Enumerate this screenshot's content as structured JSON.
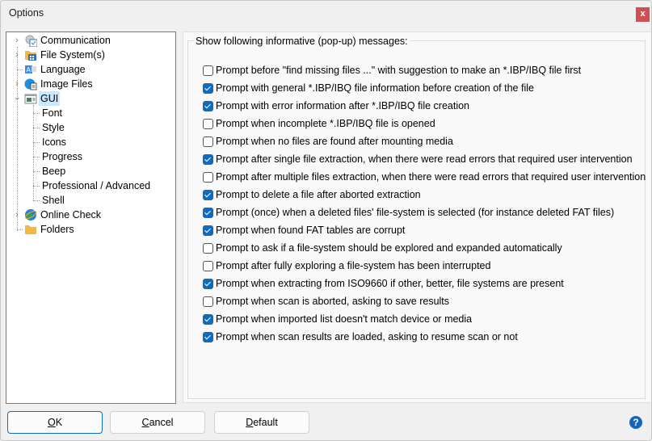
{
  "window": {
    "title": "Options",
    "close_label": "x"
  },
  "tree": {
    "items": [
      {
        "label": "Communication",
        "icon": "gear-checklist-icon",
        "expandable": true,
        "expanded": false,
        "level": 0
      },
      {
        "label": "File System(s)",
        "icon": "folder-grid-icon",
        "expandable": true,
        "expanded": false,
        "level": 0
      },
      {
        "label": "Language",
        "icon": "language-icon",
        "expandable": false,
        "level": 0
      },
      {
        "label": "Image Files",
        "icon": "image-file-icon",
        "expandable": true,
        "expanded": false,
        "level": 0
      },
      {
        "label": "GUI",
        "icon": "window-icon",
        "expandable": true,
        "expanded": true,
        "level": 0,
        "selected": true
      },
      {
        "label": "Font",
        "level": 1
      },
      {
        "label": "Style",
        "level": 1
      },
      {
        "label": "Icons",
        "level": 1
      },
      {
        "label": "Progress",
        "level": 1
      },
      {
        "label": "Beep",
        "level": 1
      },
      {
        "label": "Professional / Advanced",
        "level": 1
      },
      {
        "label": "Shell",
        "level": 1
      },
      {
        "label": "Online Check",
        "icon": "globe-icon",
        "expandable": true,
        "expanded": false,
        "level": 0
      },
      {
        "label": "Folders",
        "icon": "folder-icon",
        "expandable": false,
        "level": 0
      }
    ]
  },
  "messages_group": {
    "title": "Show following informative (pop-up) messages:",
    "options": [
      {
        "label": "Prompt before \"find missing files ...\" with suggestion to make an *.IBP/IBQ file first",
        "checked": false
      },
      {
        "label": "Prompt with general *.IBP/IBQ file information before creation of the file",
        "checked": true
      },
      {
        "label": "Prompt with error information after *.IBP/IBQ file creation",
        "checked": true
      },
      {
        "label": "Prompt when incomplete *.IBP/IBQ file is opened",
        "checked": false
      },
      {
        "label": "Prompt when no files are found after mounting media",
        "checked": false
      },
      {
        "label": "Prompt after single file extraction, when there were read errors that required user intervention",
        "checked": true
      },
      {
        "label": "Prompt after multiple files extraction, when there were read errors that required user intervention",
        "checked": false
      },
      {
        "label": "Prompt to delete a file after aborted extraction",
        "checked": true
      },
      {
        "label": "Prompt (once) when a deleted files' file-system is selected (for instance deleted FAT files)",
        "checked": true
      },
      {
        "label": "Prompt when found FAT tables are corrupt",
        "checked": true
      },
      {
        "label": "Prompt to ask if a file-system should be explored and expanded automatically",
        "checked": false
      },
      {
        "label": "Prompt after fully exploring a file-system has been interrupted",
        "checked": false
      },
      {
        "label": "Prompt when extracting from ISO9660 if other, better, file systems are present",
        "checked": true
      },
      {
        "label": "Prompt when scan is aborted, asking to save results",
        "checked": false
      },
      {
        "label": "Prompt when imported list doesn't match device or media",
        "checked": true
      },
      {
        "label": "Prompt when scan results are loaded, asking to resume scan or not",
        "checked": true
      }
    ]
  },
  "buttons": {
    "ok": {
      "mnemonic": "O",
      "rest": "K"
    },
    "cancel": {
      "mnemonic": "C",
      "rest": "ancel"
    },
    "default": {
      "mnemonic": "D",
      "rest": "efault"
    },
    "help": "?"
  },
  "colors": {
    "accent": "#0f6cbd",
    "close": "#cf4f53",
    "selection": "#cce8ff"
  }
}
